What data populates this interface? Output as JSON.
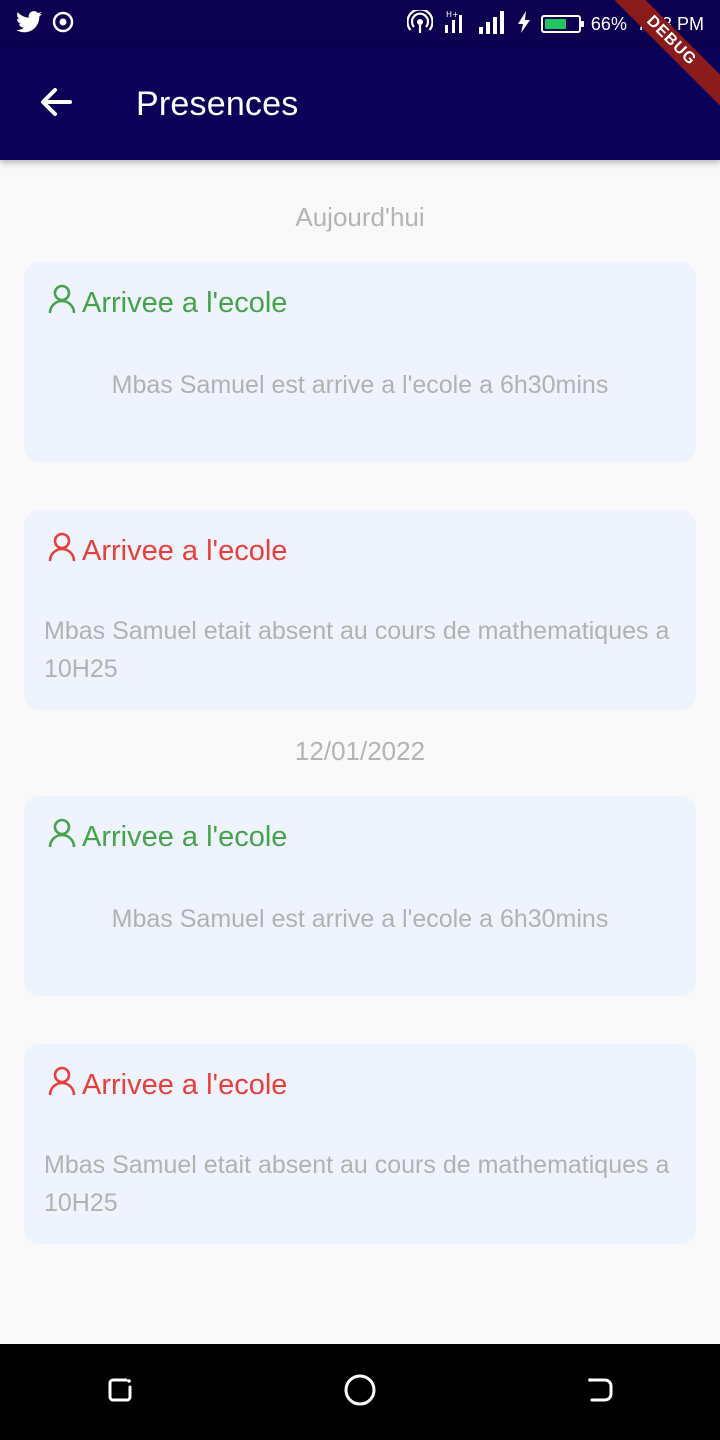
{
  "status_bar": {
    "battery": "66%",
    "time": "7:43 PM"
  },
  "debug_banner": "DEBUG",
  "app_bar": {
    "title": "Presences"
  },
  "sections": [
    {
      "date": "Aujourd'hui",
      "cards": [
        {
          "title": "Arrivee a l'ecole",
          "status": "present",
          "body": "Mbas Samuel est arrive a l'ecole a 6h30mins"
        },
        {
          "title": "Arrivee a l'ecole",
          "status": "absent",
          "body": "Mbas Samuel etait absent au cours de mathematiques a 10H25"
        }
      ]
    },
    {
      "date": "12/01/2022",
      "cards": [
        {
          "title": "Arrivee a l'ecole",
          "status": "present",
          "body": "Mbas Samuel est arrive a l'ecole a 6h30mins"
        },
        {
          "title": "Arrivee a l'ecole",
          "status": "absent",
          "body": "Mbas Samuel etait absent au cours de mathematiques a 10H25"
        }
      ]
    }
  ],
  "colors": {
    "app_bar": "#0b0158",
    "present": "#45a44a",
    "absent": "#e7403a",
    "card_bg": "#eef3fe"
  },
  "icons": {
    "status_left": [
      "twitter-icon",
      "sync-icon"
    ],
    "status_right": [
      "hotspot-icon",
      "data-signal-icon",
      "cell-signal-icon",
      "charging-icon",
      "battery-icon"
    ],
    "nav": [
      "recents-icon",
      "home-icon",
      "back-nav-icon"
    ]
  }
}
